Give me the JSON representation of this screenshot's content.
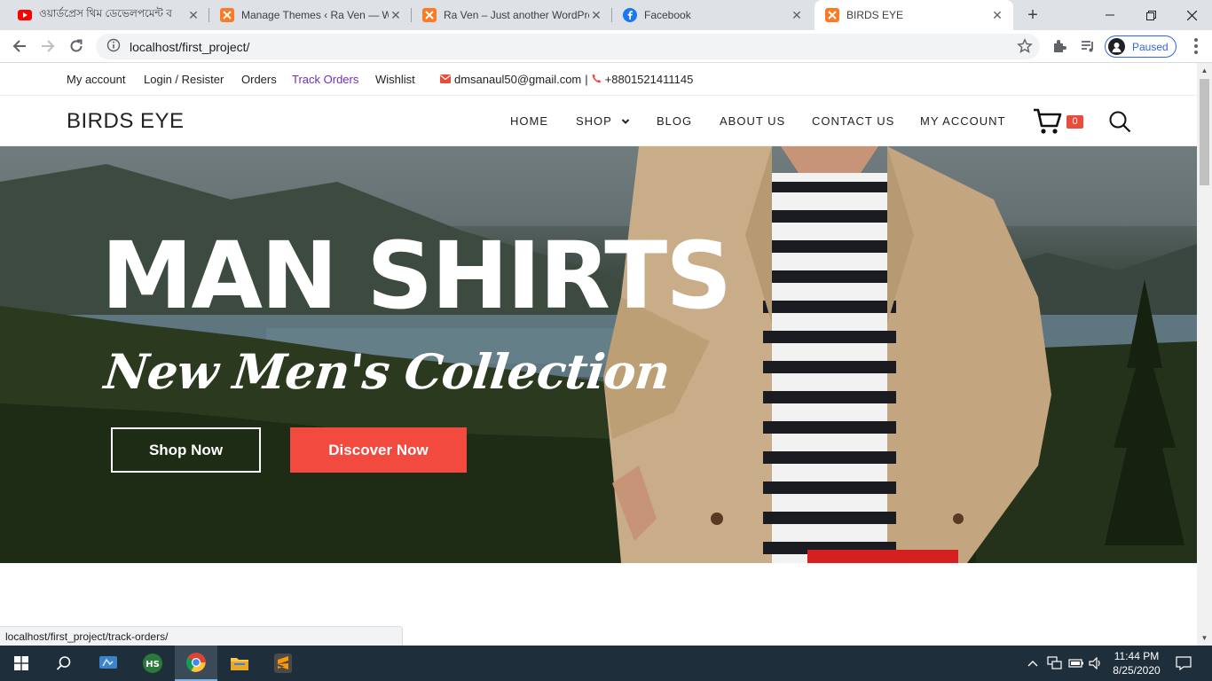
{
  "browser": {
    "tabs": [
      {
        "title": "ওয়ার্ডপ্রেস থিম ডেভেলপমেন্ট ব",
        "icon": "youtube-icon",
        "active": false
      },
      {
        "title": "Manage Themes ‹ Ra Ven — W",
        "icon": "xampp-icon",
        "active": false
      },
      {
        "title": "Ra Ven – Just another WordPre",
        "icon": "xampp-icon",
        "active": false
      },
      {
        "title": "Facebook",
        "icon": "facebook-icon",
        "active": false
      },
      {
        "title": "BIRDS EYE",
        "icon": "xampp-icon",
        "active": true
      }
    ],
    "url": "localhost/first_project/",
    "profile_label": "Paused",
    "status_url": "localhost/first_project/track-orders/"
  },
  "topbar": {
    "links": [
      "My account",
      "Login / Resister",
      "Orders",
      "Track Orders",
      "Wishlist"
    ],
    "email": "dmsanaul50@gmail.com",
    "separator": "|",
    "phone": "+8801521411145",
    "accent_color": "#6f2dbd"
  },
  "header": {
    "logo": "BIRDS EYE",
    "nav": [
      "HOME",
      "SHOP",
      "BLOG",
      "ABOUT US",
      "CONTACT US",
      "MY ACCOUNT"
    ],
    "cart_count": "0",
    "badge_color": "#e74c3c"
  },
  "hero": {
    "headline": "MAN SHIRTS",
    "subheadline": "New Men's Collection",
    "buttons": {
      "shop": "Shop Now",
      "discover": "Discover Now"
    },
    "button_color": "#f24a3f"
  },
  "taskbar": {
    "time": "11:44 PM",
    "date": "8/25/2020"
  }
}
